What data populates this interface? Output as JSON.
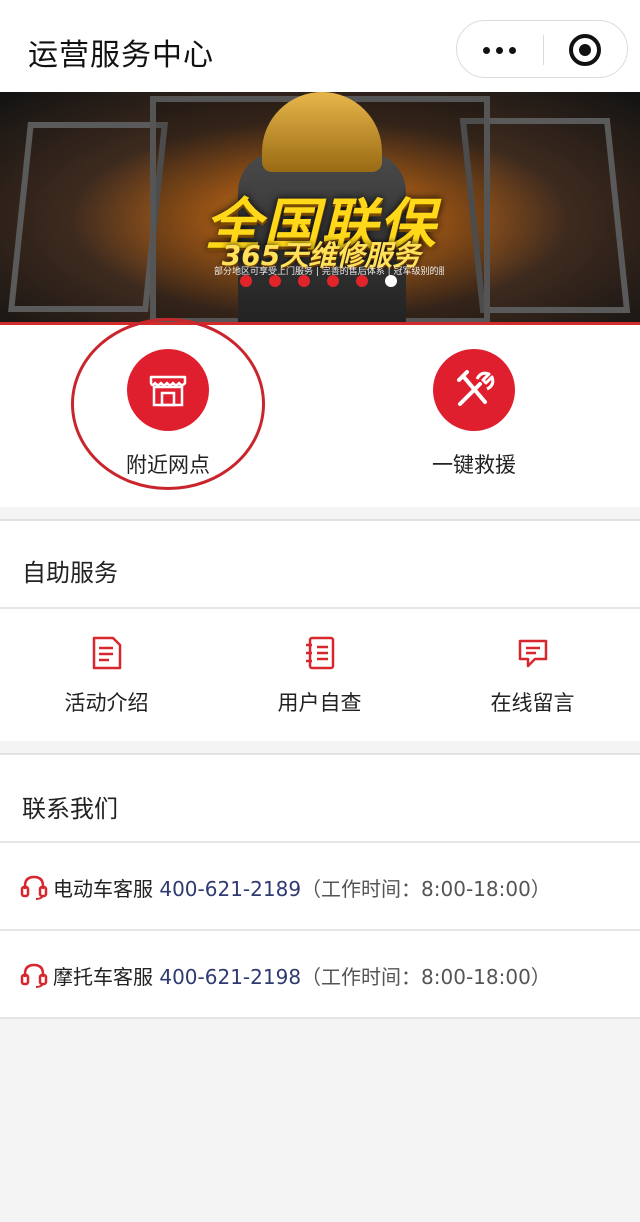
{
  "header": {
    "title": "运营服务中心",
    "more_icon": "more-dots-icon",
    "close_icon": "target-close-icon"
  },
  "banner": {
    "slogan_main": "全国联保",
    "slogan_sub": "365天维修服务",
    "slogan_small": "部分地区可享受上门服务 | 完善的售后体系 | 冠军级别的服务体验",
    "carousel_count": 6,
    "carousel_active": 6
  },
  "quick_actions": [
    {
      "label": "附近网点",
      "icon": "store-icon"
    },
    {
      "label": "一键救援",
      "icon": "tools-icon"
    }
  ],
  "self_service": {
    "title": "自助服务",
    "items": [
      {
        "label": "活动介绍",
        "icon": "document-icon"
      },
      {
        "label": "用户自查",
        "icon": "notebook-icon"
      },
      {
        "label": "在线留言",
        "icon": "message-icon"
      }
    ]
  },
  "contact": {
    "title": "联系我们",
    "rows": [
      {
        "name": "电动车客服",
        "phone": "400-621-2189",
        "hours": "（工作时间：8:00-18:00）",
        "icon": "headset-icon"
      },
      {
        "name": "摩托车客服",
        "phone": "400-621-2198",
        "hours": "（工作时间：8:00-18:00）",
        "icon": "headset-icon"
      }
    ]
  },
  "colors": {
    "accent": "#e01f2e",
    "phone": "#2e3a70",
    "background": "#f4f4f4"
  }
}
